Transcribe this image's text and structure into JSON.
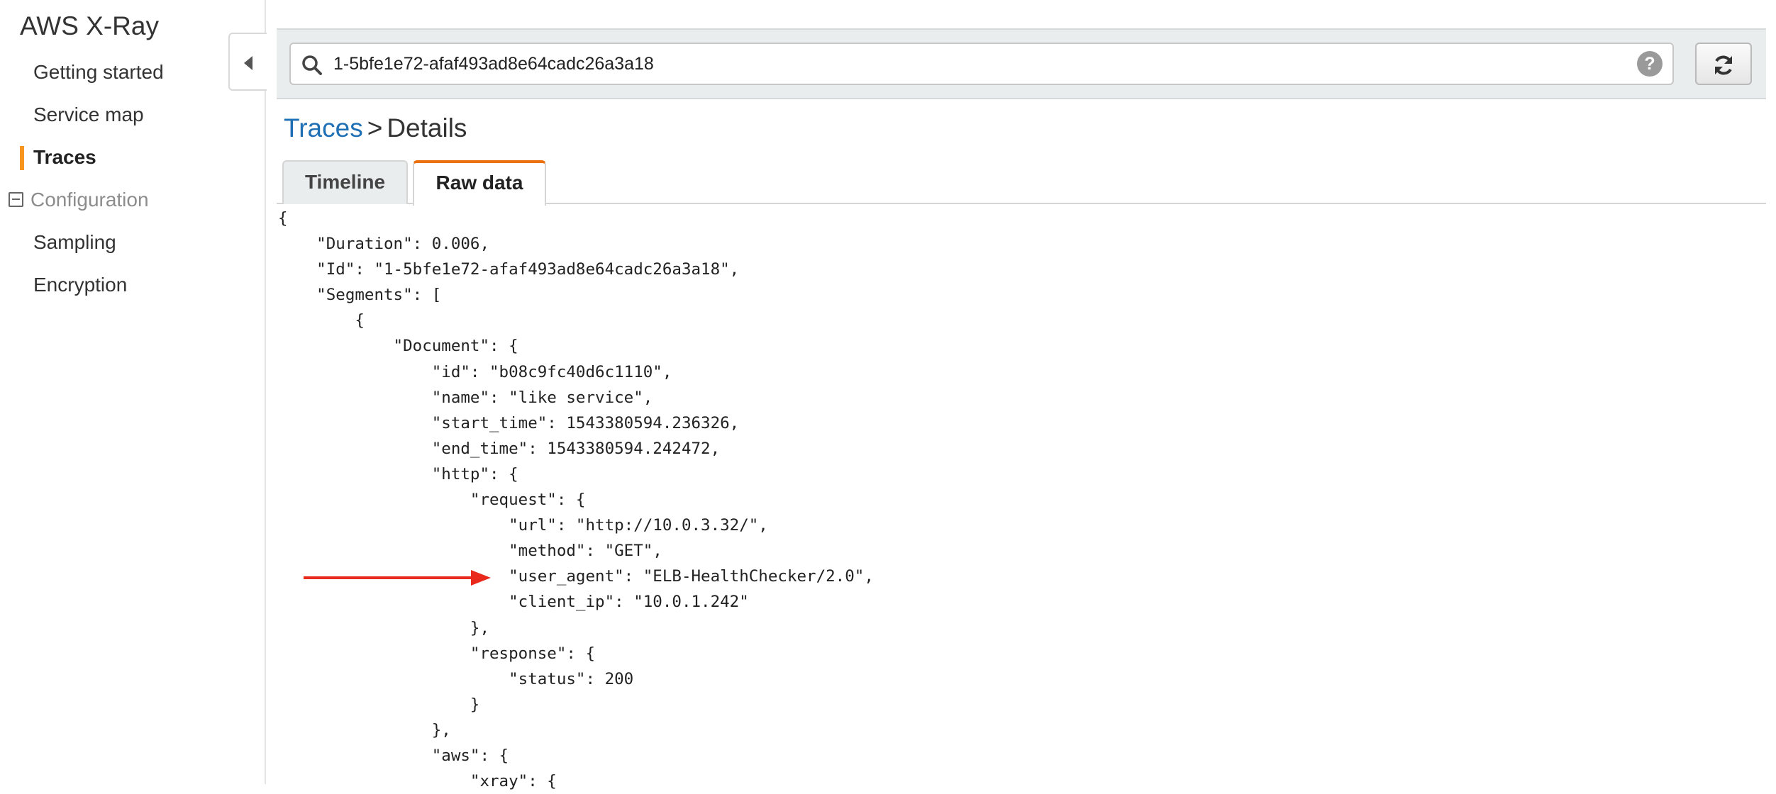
{
  "app": {
    "title": "AWS X-Ray"
  },
  "sidebar": {
    "items": [
      {
        "label": "Getting started",
        "active": false
      },
      {
        "label": "Service map",
        "active": false
      },
      {
        "label": "Traces",
        "active": true
      }
    ],
    "section": {
      "label": "Configuration",
      "icon": "collapse-minus-icon"
    },
    "sub_items": [
      {
        "label": "Sampling"
      },
      {
        "label": "Encryption"
      }
    ],
    "toggle_icon": "chevron-left-icon"
  },
  "search": {
    "value": "1-5bfe1e72-afaf493ad8e64cadc26a3a18",
    "icon": "search-icon",
    "help_icon_label": "?"
  },
  "refresh_button": {
    "icon": "refresh-icon"
  },
  "breadcrumb": {
    "link": "Traces",
    "separator": ">",
    "current": "Details"
  },
  "tabs": [
    {
      "label": "Timeline",
      "active": false
    },
    {
      "label": "Raw data",
      "active": true
    }
  ],
  "raw_data": {
    "lines": [
      "{",
      "    \"Duration\": 0.006,",
      "    \"Id\": \"1-5bfe1e72-afaf493ad8e64cadc26a3a18\",",
      "    \"Segments\": [",
      "        {",
      "            \"Document\": {",
      "                \"id\": \"b08c9fc40d6c1110\",",
      "                \"name\": \"like service\",",
      "                \"start_time\": 1543380594.236326,",
      "                \"end_time\": 1543380594.242472,",
      "                \"http\": {",
      "                    \"request\": {",
      "                        \"url\": \"http://10.0.3.32/\",",
      "                        \"method\": \"GET\",",
      "                        \"user_agent\": \"ELB-HealthChecker/2.0\",",
      "                        \"client_ip\": \"10.0.1.242\"",
      "                    },",
      "                    \"response\": {",
      "                        \"status\": 200",
      "                    }",
      "                },",
      "                \"aws\": {",
      "                    \"xray\": {"
    ]
  },
  "annotation": {
    "arrow_color": "#e8291c"
  },
  "colors": {
    "accent_orange": "#ec7211",
    "link_blue": "#1f6fb5",
    "active_marker": "#f7941e"
  }
}
